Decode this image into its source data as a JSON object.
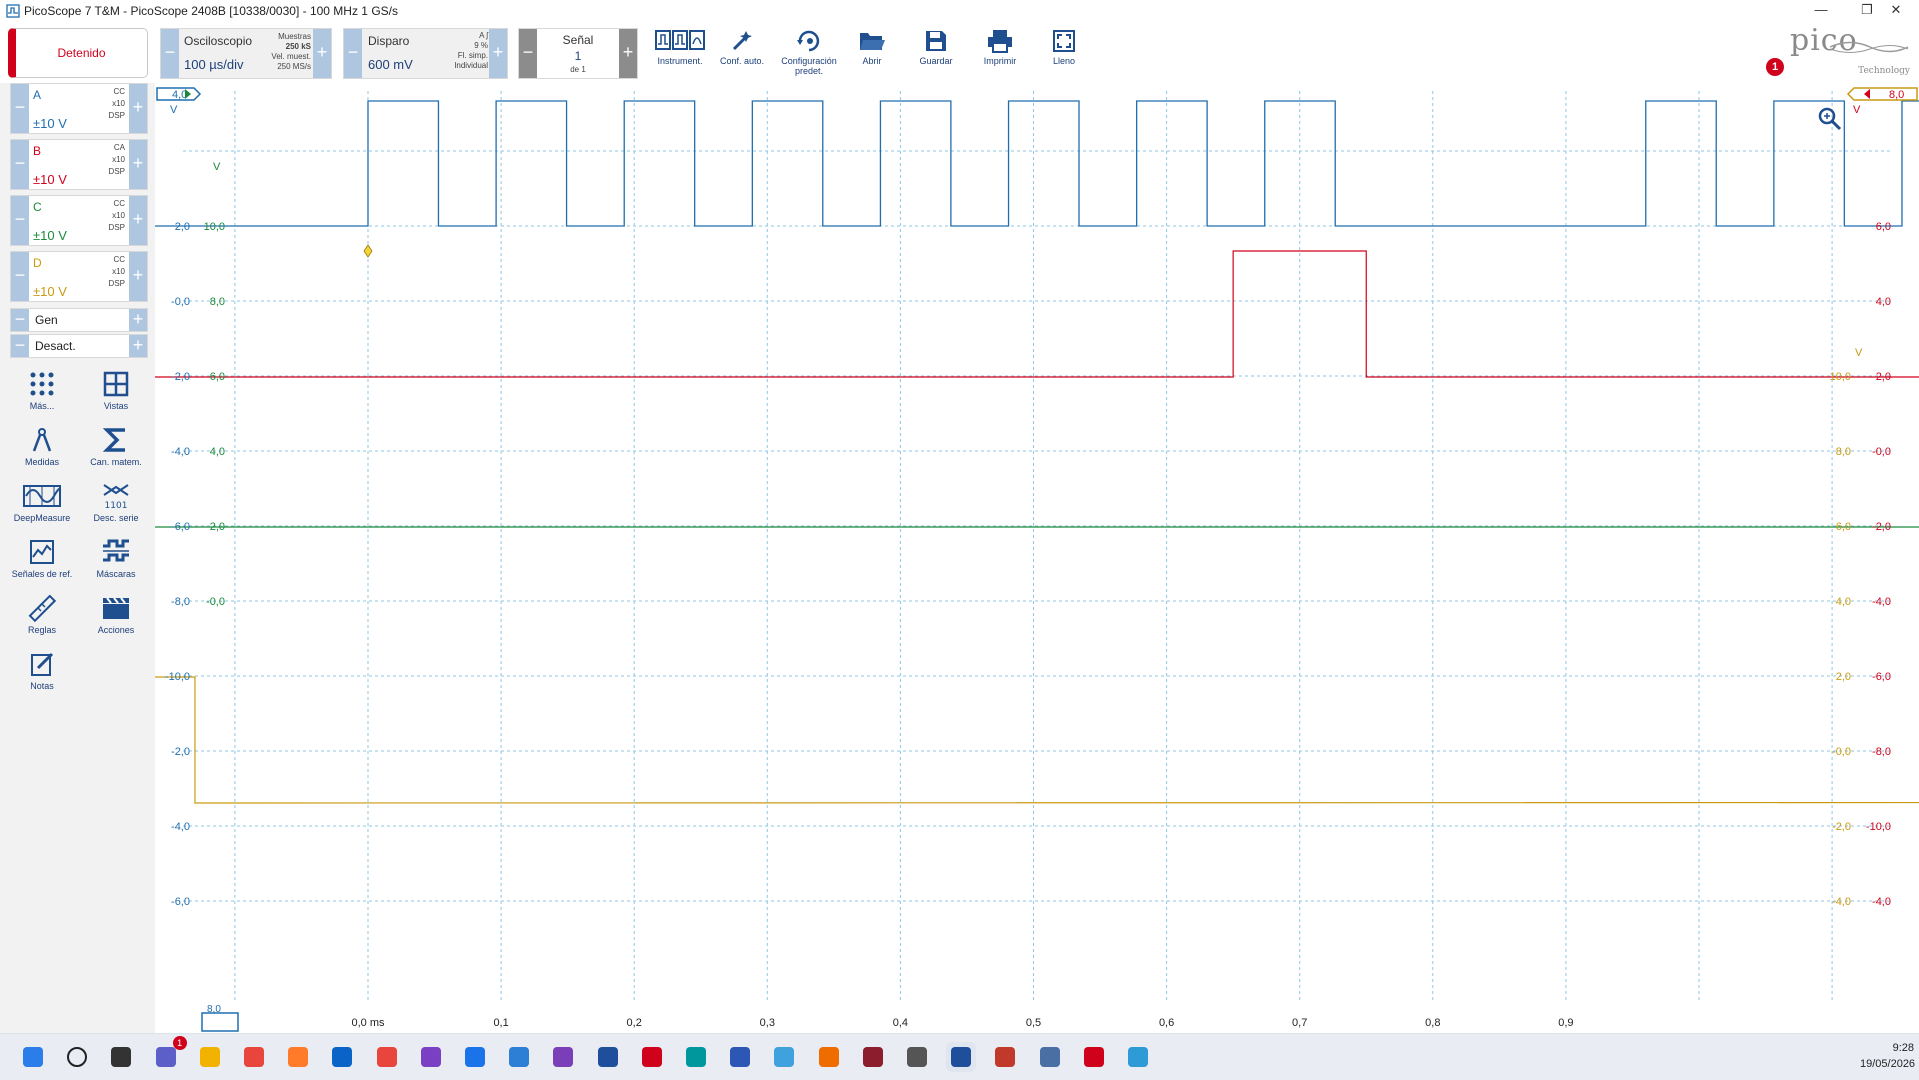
{
  "window": {
    "title": "PicoScope 7 T&M  - PicoScope 2408B [10338/0030] - 100 MHz 1 GS/s",
    "minimize": "—",
    "maximize": "❐",
    "close": "✕"
  },
  "toolbar": {
    "stop_label": "Detenido",
    "scope": {
      "label": "Osciloscopio",
      "value": "100 µs/div",
      "samples_label": "Muestras",
      "samples_value": "250 kS",
      "rate_label": "Vel. muest.",
      "rate_value": "250 MS/s"
    },
    "trigger": {
      "label": "Disparo",
      "value": "600 mV",
      "channel": "A",
      "percent": "9 %",
      "mode1": "Fl. simp.",
      "mode2": "Individual"
    },
    "signal": {
      "label": "Señal",
      "value": "1",
      "of": "de 1"
    },
    "tools": [
      {
        "name": "instruments",
        "label": "Instrument."
      },
      {
        "name": "autosetup",
        "label": "Conf. auto."
      },
      {
        "name": "default-setup",
        "label": "Configuración predet."
      },
      {
        "name": "open",
        "label": "Abrir"
      },
      {
        "name": "save",
        "label": "Guardar"
      },
      {
        "name": "print",
        "label": "Imprimir"
      },
      {
        "name": "full",
        "label": "Lleno"
      }
    ],
    "logo_text": "pico",
    "logo_sub": "Technology",
    "alert_count": "1"
  },
  "channels": [
    {
      "id": "A",
      "coupling": "CC",
      "probe": "x10",
      "dsp": "DSP",
      "range": "±10 V",
      "color": "#1f6eb0"
    },
    {
      "id": "B",
      "coupling": "CA",
      "probe": "x10",
      "dsp": "DSP",
      "range": "±10 V",
      "color": "#d0021b"
    },
    {
      "id": "C",
      "coupling": "CC",
      "probe": "x10",
      "dsp": "DSP",
      "range": "±10 V",
      "color": "#1a8a3a"
    },
    {
      "id": "D",
      "coupling": "CC",
      "probe": "x10",
      "dsp": "DSP",
      "range": "±10 V",
      "color": "#c99a10"
    }
  ],
  "gen": {
    "label": "Gen",
    "off": "Desact."
  },
  "side_tools": [
    {
      "name": "more",
      "label": "Más..."
    },
    {
      "name": "views",
      "label": "Vistas"
    },
    {
      "name": "measurements",
      "label": "Medidas"
    },
    {
      "name": "math",
      "label": "Can. matem."
    },
    {
      "name": "deepmeasure",
      "label": "DeepMeasure"
    },
    {
      "name": "serial",
      "label": "Desc. serie"
    },
    {
      "name": "reference",
      "label": "Señales de ref."
    },
    {
      "name": "masks",
      "label": "Máscaras"
    },
    {
      "name": "rulers",
      "label": "Reglas"
    },
    {
      "name": "actions",
      "label": "Acciones"
    },
    {
      "name": "notes",
      "label": "Notas"
    }
  ],
  "scope_view": {
    "left_marker": "4,0",
    "right_marker": "8,0",
    "bottom_marker": "8,0",
    "unit": "V",
    "x_labels": [
      "0,0 ms",
      "0,1",
      "0,2",
      "0,3",
      "0,4",
      "0,5",
      "0,6",
      "0,7",
      "0,8",
      "0,9"
    ],
    "axis_blue": [
      "2,0",
      "-0,0",
      "-2,0",
      "-4,0",
      "-6,0",
      "-8,0",
      "-10,0",
      "-2,0",
      "-4,0",
      "-6,0"
    ],
    "axis_green": [
      "10,0",
      "8,0",
      "6,0",
      "4,0",
      "2,0",
      "-0,0"
    ],
    "axis_red": [
      "6,0",
      "4,0",
      "2,0",
      "-0,0",
      "-2,0",
      "-4,0",
      "-6,0",
      "-8,0",
      "-10,0",
      "-4,0"
    ],
    "axis_gold": [
      "10,0",
      "8,0",
      "6,0",
      "4,0",
      "2,0",
      "-0,0",
      "-2,0",
      "-4,0"
    ],
    "axis_left_top": "4,0",
    "axis_right_top": "8,0"
  },
  "taskbar": {
    "time": "9:28",
    "date": "19/05/2026",
    "teams_badge": "1",
    "apps": [
      "windows-start",
      "search",
      "task-view",
      "teams",
      "file-explorer",
      "chrome",
      "firefox",
      "outlook",
      "anydesk",
      "obsidian",
      "maps",
      "vscode",
      "visual-studio",
      "jlink",
      "cube-red",
      "arduino",
      "kicad",
      "diagram-app",
      "office-app",
      "altium",
      "kinetic",
      "picoscope",
      "erp",
      "network",
      "cube-red-2",
      "globe-app"
    ]
  }
}
